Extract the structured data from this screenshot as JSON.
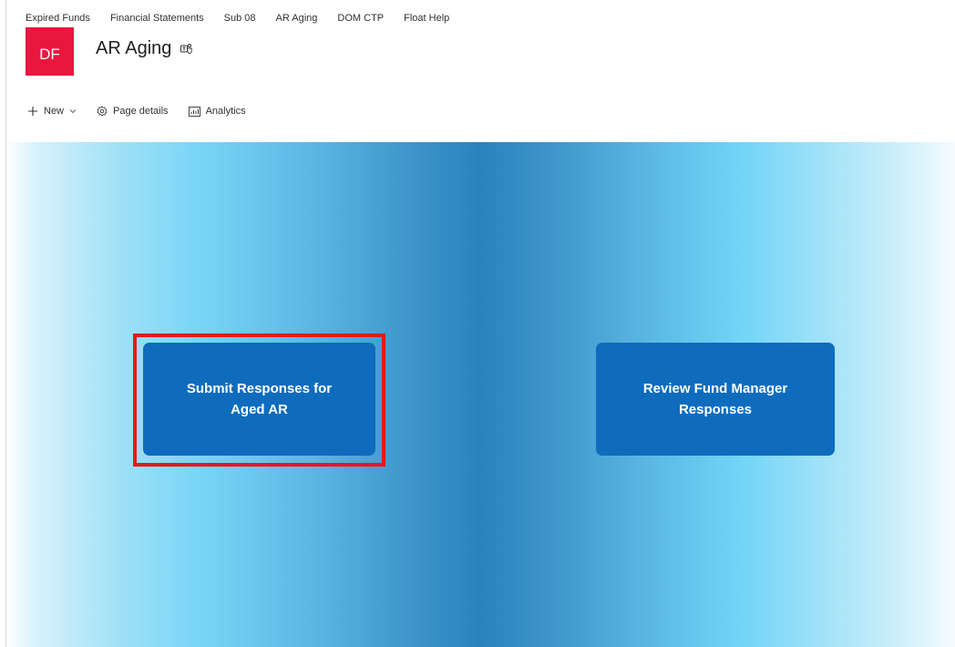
{
  "topnav": {
    "items": [
      "Expired Funds",
      "Financial Statements",
      "Sub 08",
      "AR Aging",
      "DOM CTP",
      "Float Help"
    ]
  },
  "site": {
    "logo_text": "DF",
    "logo_color": "#e8173f",
    "title": "AR Aging"
  },
  "commandbar": {
    "new_label": "New",
    "page_details_label": "Page details",
    "analytics_label": "Analytics"
  },
  "tiles": {
    "left": {
      "line1": "Submit Responses for",
      "line2": "Aged AR"
    },
    "right": {
      "line1": "Review Fund Manager",
      "line2": "Responses"
    },
    "color": "#0f6cbd"
  },
  "highlight_color": "#e01b1b"
}
